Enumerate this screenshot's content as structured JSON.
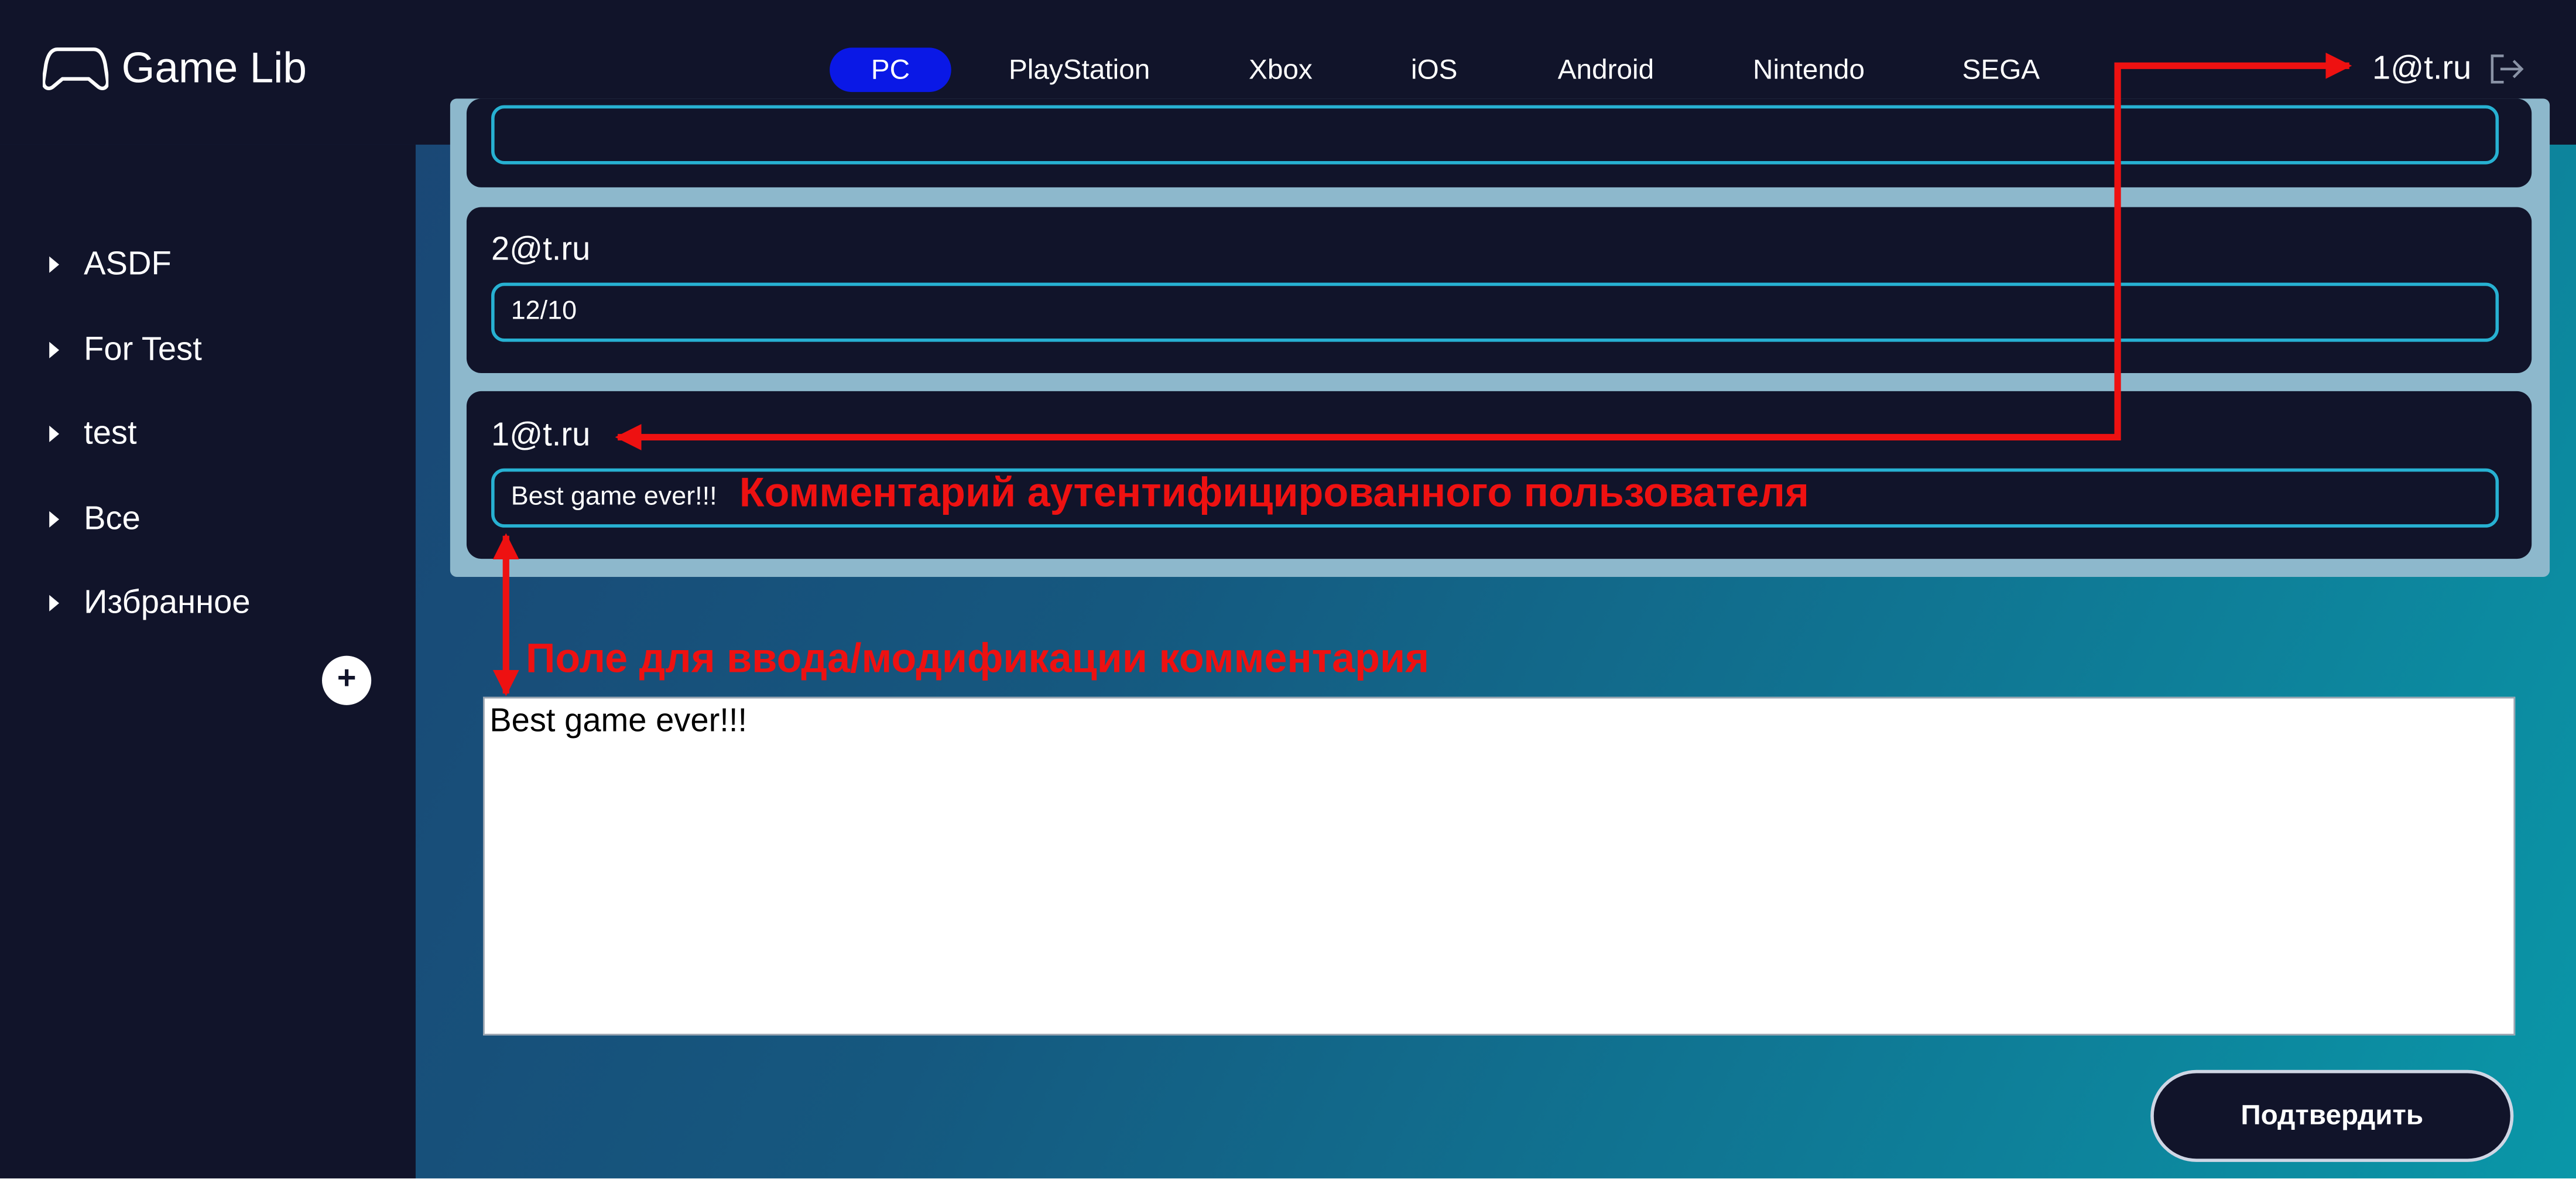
{
  "app": {
    "title": "Game Lib"
  },
  "nav": {
    "platforms": [
      "PC",
      "PlayStation",
      "Xbox",
      "iOS",
      "Android",
      "Nintendo",
      "SEGA"
    ],
    "active": "PC"
  },
  "user": {
    "email": "1@t.ru"
  },
  "sidebar": {
    "items": [
      {
        "label": "ASDF"
      },
      {
        "label": "For Test"
      },
      {
        "label": "test"
      },
      {
        "label": "Все"
      },
      {
        "label": "Избранное"
      }
    ],
    "add_label": "+"
  },
  "comments": [
    {
      "author": "2@t.ru",
      "text": "12/10"
    },
    {
      "author": "1@t.ru",
      "text": "Best game ever!!!"
    }
  ],
  "comment_form": {
    "value": "Best game ever!!!",
    "submit_label": "Подтвердить"
  },
  "annotations": {
    "own_comment": "Комментарий аутентифицированного пользователя",
    "input_field": "Поле для ввода/модификации комментария",
    "color": "#ee1111"
  },
  "colors": {
    "header_bg": "#11142a",
    "active_tab": "#0a18e6",
    "input_border": "#27b1d2"
  }
}
